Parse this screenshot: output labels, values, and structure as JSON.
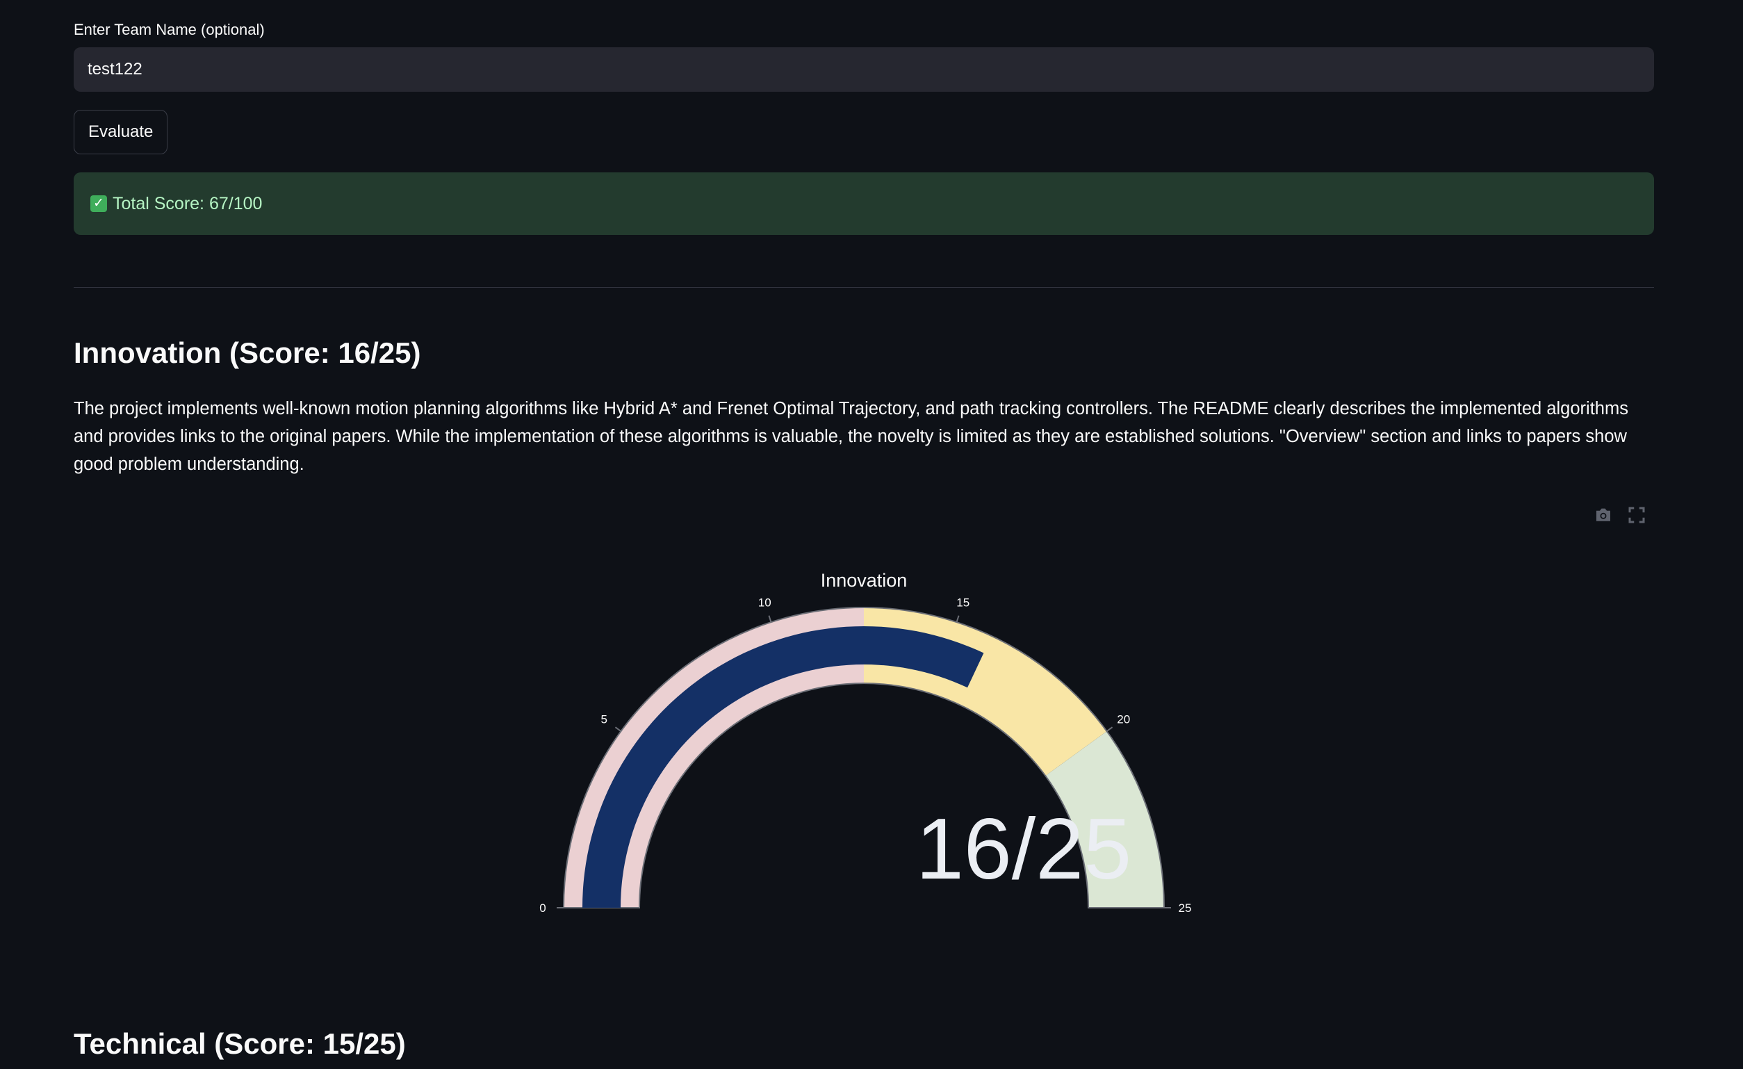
{
  "form": {
    "team_label": "Enter Team Name (optional)",
    "team_value": "test122",
    "evaluate_label": "Evaluate"
  },
  "result": {
    "total_score_text": "Total Score: 67/100",
    "check_icon": "✓"
  },
  "innovation": {
    "heading": "Innovation (Score: 16/25)",
    "description": "The project implements well-known motion planning algorithms like Hybrid A* and Frenet Optimal Trajectory, and path tracking controllers. The README clearly describes the implemented algorithms and provides links to the original papers. While the implementation of these algorithms is valuable, the novelty is limited as they are established solutions. \"Overview\" section and links to papers show good problem understanding."
  },
  "toolbar": {
    "icons": [
      "camera-icon",
      "fullscreen-icon"
    ]
  },
  "chart_data": {
    "type": "gauge",
    "title": "Innovation",
    "value": 16,
    "display_text": "16/25",
    "range": [
      0,
      25
    ],
    "ticks": [
      0,
      5,
      10,
      15,
      20,
      25
    ],
    "steps": [
      {
        "range": [
          0,
          12.5
        ],
        "color": "#ebd0d2"
      },
      {
        "range": [
          12.5,
          20
        ],
        "color": "#f9e6a6"
      },
      {
        "range": [
          20,
          25
        ],
        "color": "#dbe7d4"
      }
    ],
    "bar_color": "#143066"
  },
  "technical": {
    "heading": "Technical (Score: 15/25)"
  }
}
